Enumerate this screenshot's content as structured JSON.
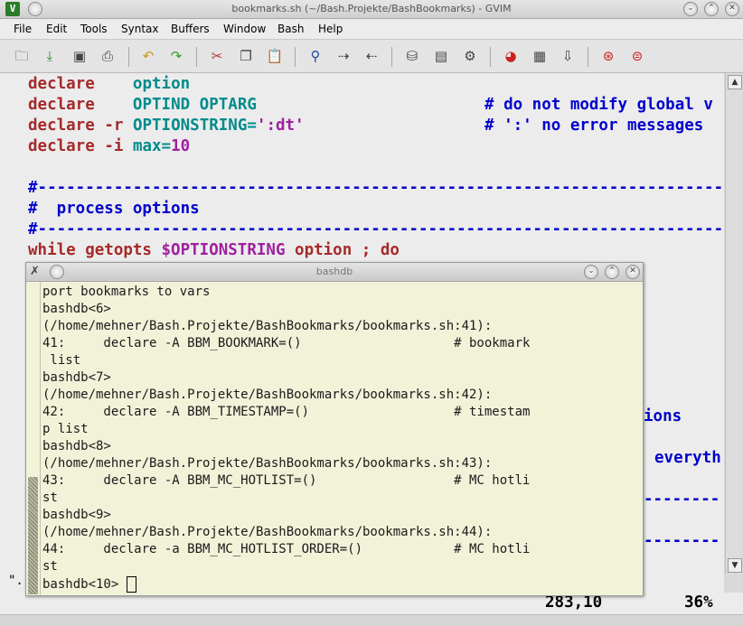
{
  "window": {
    "title": "bookmarks.sh (~/Bash.Projekte/BashBookmarks) - GVIM",
    "app_icon": "vim-icon"
  },
  "menu": [
    "File",
    "Edit",
    "Tools",
    "Syntax",
    "Buffers",
    "Window",
    "Bash",
    "Help"
  ],
  "toolbar_icons": [
    "open-icon",
    "save-session-icon",
    "save-icon",
    "print-icon",
    "undo-icon",
    "redo-icon",
    "cut-icon",
    "copy-icon",
    "paste-icon",
    "find-replace-icon",
    "find-next-icon",
    "find-prev-icon",
    "load-session-icon",
    "save-session-icon",
    "run-script-icon",
    "make-icon",
    "build-tags-icon",
    "jump-tag-icon",
    "help-icon",
    "find-help-icon"
  ],
  "editor": {
    "lines": [
      {
        "declare": "declare",
        "flag": "",
        "name": "option",
        "rest": "",
        "comment": ""
      },
      {
        "declare": "declare",
        "flag": "",
        "name": "OPTIND OPTARG",
        "rest": "",
        "comment": "# do not modify global v"
      },
      {
        "declare": "declare",
        "flag": "-r",
        "name": "OPTIONSTRING=",
        "rest": "':dt'",
        "comment": "# ':' no error messages"
      },
      {
        "declare": "declare",
        "flag": "-i",
        "name": "max=",
        "rest": "10",
        "comment": ""
      }
    ],
    "rule1": "#-----------------------------------------------------------------------------",
    "section_comment": "#  process options",
    "rule2": "#-----------------------------------------------------------------------------",
    "while_kw": "while getopts",
    "while_var": "$OPTIONSTRING",
    "while_rest": "option ; do",
    "frag_ions": "ions",
    "frag_everyth": "everyth",
    "frag_dashes1": "--------",
    "frag_dashes2": "--------",
    "frag_quote": "\"."
  },
  "status": {
    "position": "283,10",
    "percent": "36%"
  },
  "dialog": {
    "title": "bashdb",
    "lines": [
      "port bookmarks to vars",
      "bashdb<6>",
      "(/home/mehner/Bash.Projekte/BashBookmarks/bookmarks.sh:41):",
      "41:     declare -A BBM_BOOKMARK=()                    # bookmark",
      " list",
      "bashdb<7>",
      "(/home/mehner/Bash.Projekte/BashBookmarks/bookmarks.sh:42):",
      "42:     declare -A BBM_TIMESTAMP=()                   # timestam",
      "p list",
      "bashdb<8>",
      "(/home/mehner/Bash.Projekte/BashBookmarks/bookmarks.sh:43):",
      "43:     declare -A BBM_MC_HOTLIST=()                  # MC hotli",
      "st",
      "bashdb<9>",
      "(/home/mehner/Bash.Projekte/BashBookmarks/bookmarks.sh:44):",
      "44:     declare -a BBM_MC_HOTLIST_ORDER=()            # MC hotli",
      "st"
    ],
    "prompt": "bashdb<10> "
  }
}
